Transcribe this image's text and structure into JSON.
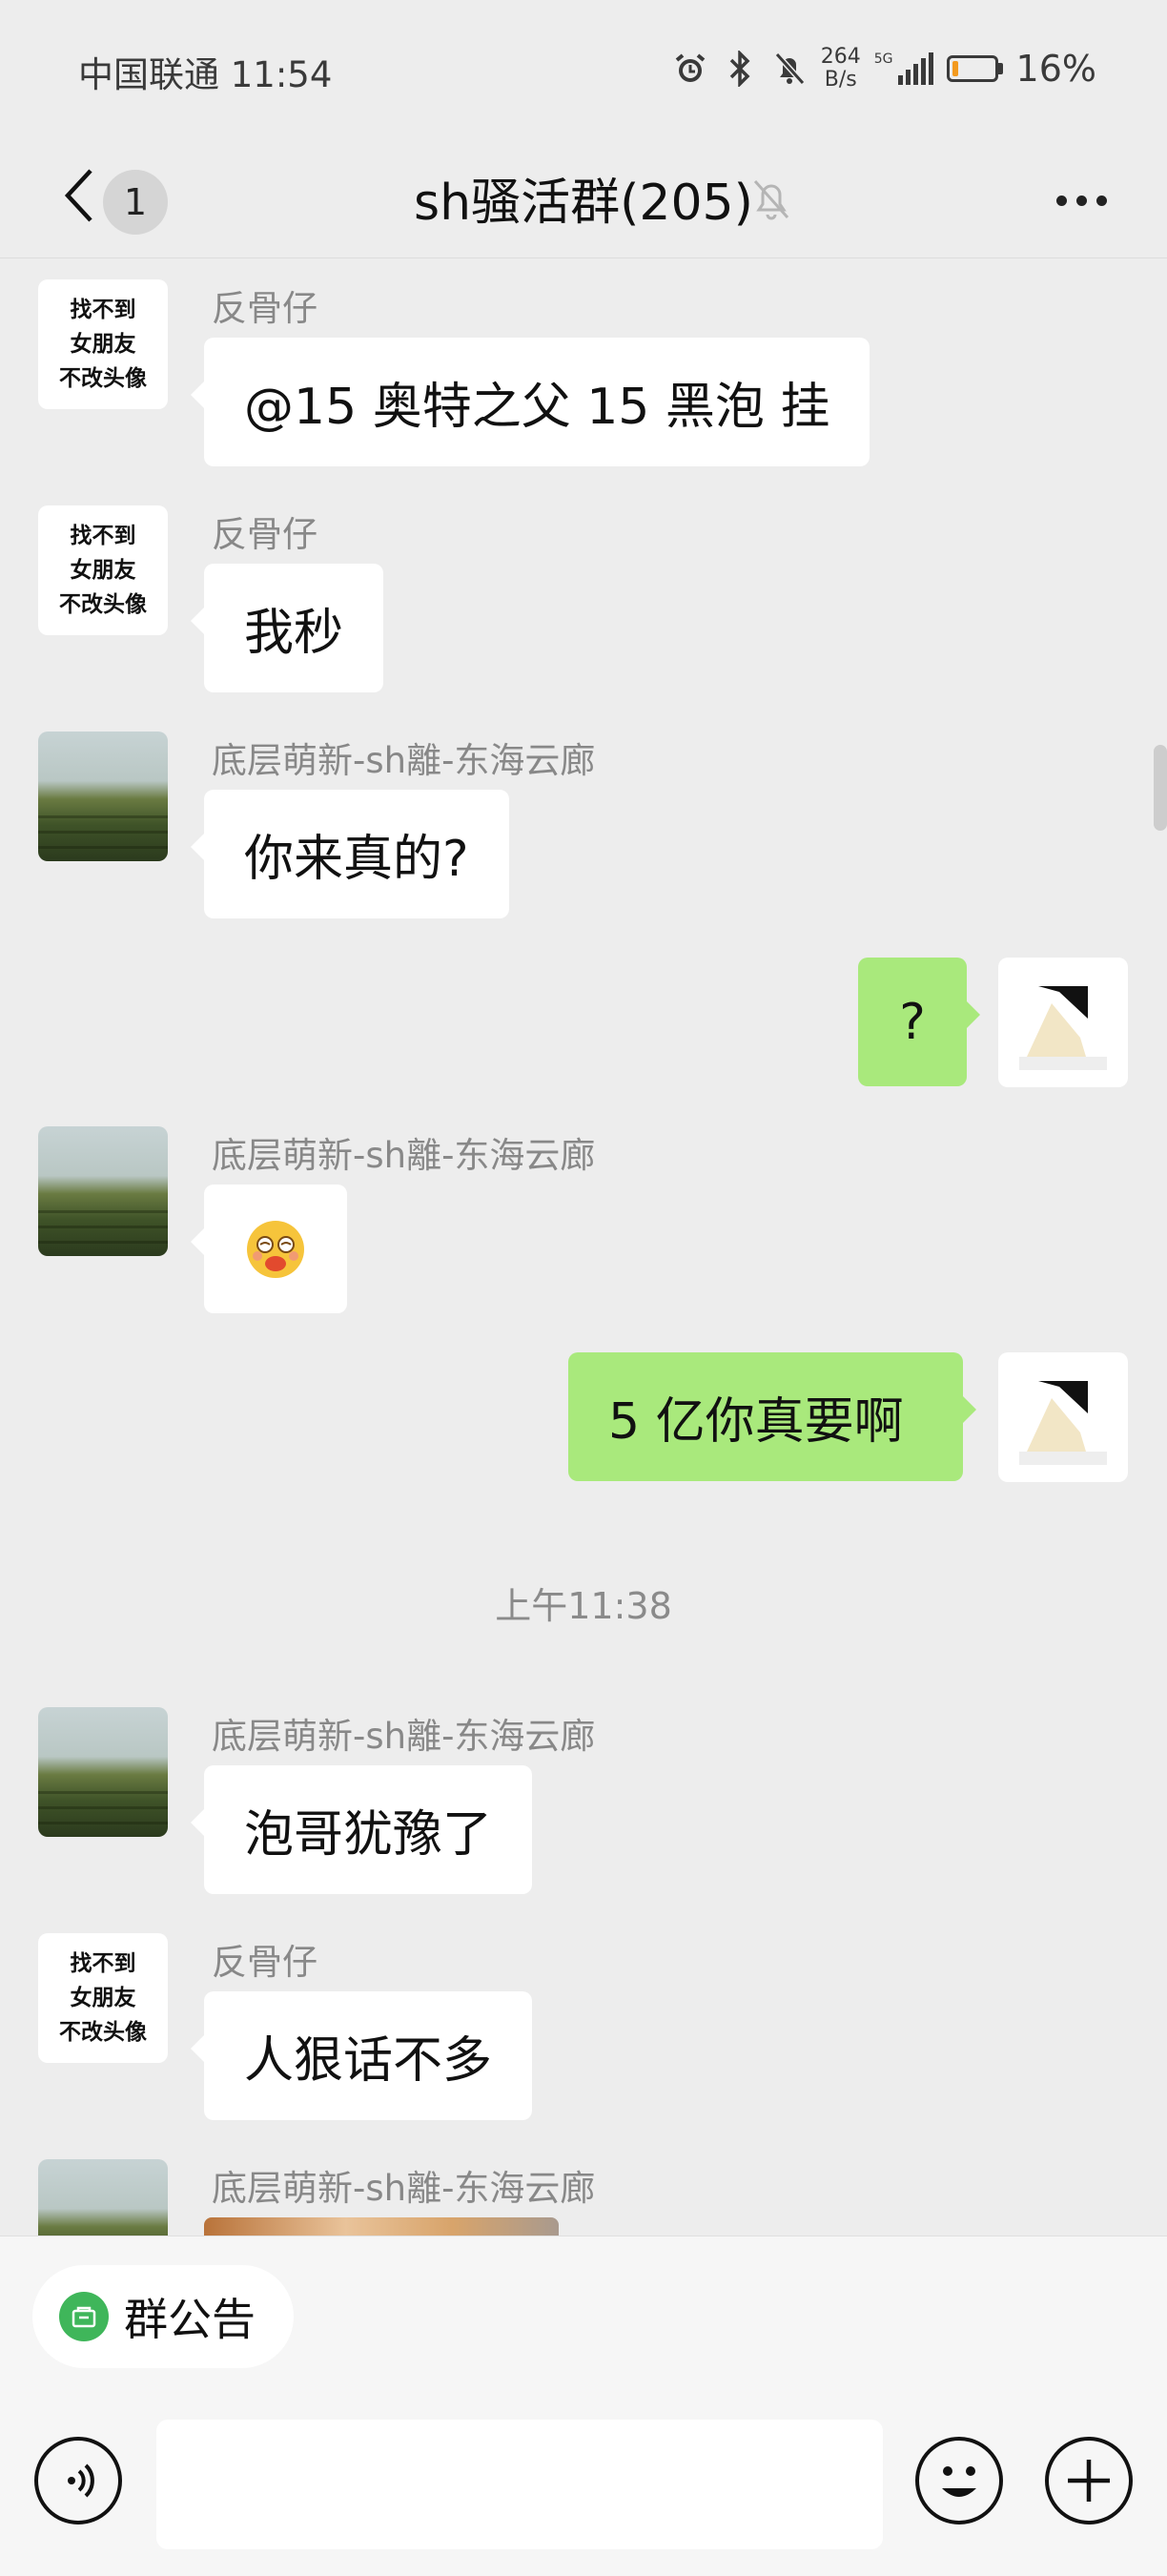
{
  "status_bar": {
    "carrier_time": "中国联通 11:54",
    "speed_value": "264",
    "speed_unit": "B/s",
    "signal_label": "5G",
    "battery_level": 0.16,
    "battery_percent": "16%"
  },
  "header": {
    "unread_count": "1",
    "title": "sh骚活群(205)",
    "muted": true
  },
  "messages": [
    {
      "sender": "反骨仔",
      "text": "@15 奥特之父 15 黑泡  挂",
      "direction": "in",
      "avatar": "text-avatar"
    },
    {
      "sender": "反骨仔",
      "text": "我秒",
      "direction": "in",
      "avatar": "text-avatar"
    },
    {
      "sender": "底层萌新-sh離-东海云廊",
      "text": "你来真的?",
      "direction": "in",
      "avatar": "field-avatar"
    },
    {
      "text": "?",
      "direction": "out",
      "avatar": "self-avatar"
    },
    {
      "sender": "底层萌新-sh離-东海云廊",
      "emoji": "dizzy-smile-emoji",
      "direction": "in",
      "avatar": "field-avatar"
    },
    {
      "text": "5 亿你真要啊",
      "direction": "out",
      "avatar": "self-avatar"
    },
    {
      "sender": "底层萌新-sh離-东海云廊",
      "text": "泡哥犹豫了",
      "direction": "in",
      "avatar": "field-avatar"
    },
    {
      "sender": "反骨仔",
      "text": "人狠话不多",
      "direction": "in",
      "avatar": "text-avatar"
    },
    {
      "sender": "底层萌新-sh離-东海云廊",
      "image": "photo-message",
      "direction": "in",
      "avatar": "field-avatar"
    }
  ],
  "timestamp": "上午11:38",
  "text_avatar_caption": "找不到\n女朋友\n不改头像",
  "bottom_bar": {
    "notice_label": "群公告",
    "input_value": ""
  },
  "colors": {
    "background": "#ededed",
    "bubble_in": "#ffffff",
    "bubble_out": "#a9e97c",
    "notice_icon": "#3fb65a"
  }
}
